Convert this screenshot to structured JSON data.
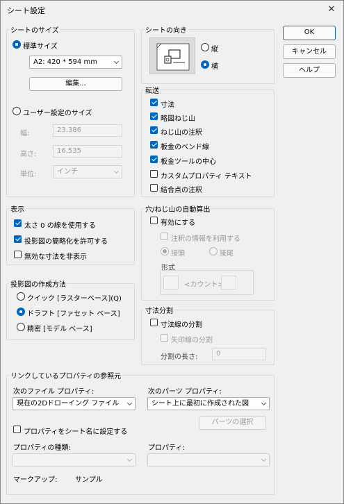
{
  "window": {
    "title": "シート設定",
    "close_glyph": "✕"
  },
  "buttons": {
    "ok": "OK",
    "cancel": "キャンセル",
    "help": "ヘルプ"
  },
  "sheet_size": {
    "group_label": "シートのサイズ",
    "standard_label": "標準サイズ",
    "standard_value": "A2: 420 * 594 mm",
    "edit_label": "編集...",
    "user_defined_label": "ユーザー設定のサイズ",
    "width_label": "幅:",
    "width_value": "23.386",
    "height_label": "高さ:",
    "height_value": "16.535",
    "unit_label": "単位:",
    "unit_value": "インチ"
  },
  "orientation": {
    "group_label": "シートの向き",
    "portrait_label": "縦",
    "landscape_label": "横"
  },
  "transfer": {
    "group_label": "転送",
    "items": [
      {
        "label": "寸法",
        "checked": true
      },
      {
        "label": "略図ねじ山",
        "checked": true
      },
      {
        "label": "ねじ山の注釈",
        "checked": true
      },
      {
        "label": "板金のベンド線",
        "checked": true
      },
      {
        "label": "板金ツールの中心",
        "checked": true
      },
      {
        "label": "カスタムプロパティ テキスト",
        "checked": false
      },
      {
        "label": "結合点の注釈",
        "checked": false
      }
    ]
  },
  "display": {
    "group_label": "表示",
    "items": [
      {
        "label": "太さ 0 の線を使用する",
        "checked": true
      },
      {
        "label": "投影図の簡略化を許可する",
        "checked": true
      },
      {
        "label": "無効な寸法を非表示",
        "checked": false
      }
    ]
  },
  "projection": {
    "group_label": "投影図の作成方法",
    "quick_label": "クイック [ラスターベース](Q)",
    "draft_label": "ドラフト [ファセット ベース]",
    "precise_label": "精密 [モデル ベース]"
  },
  "hole_thread": {
    "group_label": "穴/ねじ山の自動算出",
    "enable_label": "有効にする",
    "use_note_label": "注釈の情報を利用する",
    "head_label": "接頭",
    "tail_label": "接尾",
    "format_label": "形式",
    "count_placeholder": "<カウント>"
  },
  "dim_split": {
    "group_label": "寸法分割",
    "split_dim_label": "寸法線の分割",
    "split_arrow_label": "矢印線の分割",
    "split_length_label": "分割の長さ:",
    "split_length_value": "0"
  },
  "linked": {
    "group_label": "リンクしているプロパティの参照元",
    "file_prop_label": "次のファイル プロパティ:",
    "file_prop_value": "現在の2Dドローイング ファイル",
    "part_prop_label": "次のパーツ プロパティ:",
    "part_prop_value": "シート上に最初に作成された図",
    "select_part_label": "パーツの選択",
    "set_name_label": "プロパティをシート名に設定する",
    "prop_type_label": "プロパティの種類:",
    "prop_label": "プロパティ:",
    "markup_label": "マークアップ:",
    "markup_value": "サンプル"
  }
}
